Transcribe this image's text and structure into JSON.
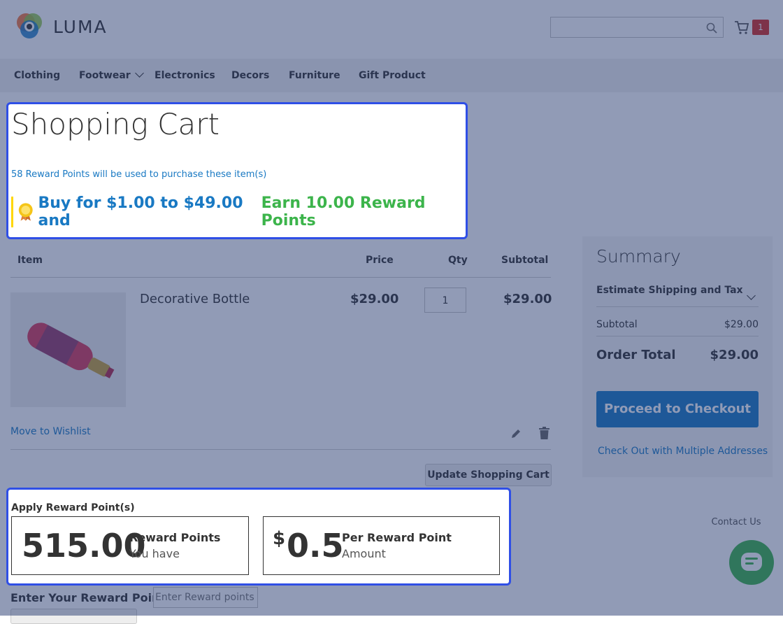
{
  "header": {
    "brand": "LUMA",
    "search_placeholder": "",
    "cart_count": "1"
  },
  "nav": {
    "items": [
      "Clothing",
      "Footwear",
      "Electronics",
      "Decors",
      "Furniture",
      "Gift Product"
    ]
  },
  "page": {
    "title": "Shopping Cart",
    "reward_note": "58 Reward Points will be used to purchase these item(s)",
    "earn_part1": "Buy for $1.00 to $49.00 and",
    "earn_part2": "Earn 10.00 Reward Points"
  },
  "cart": {
    "headers": {
      "item": "Item",
      "price": "Price",
      "qty": "Qty",
      "subtotal": "Subtotal"
    },
    "rows": [
      {
        "name": "Decorative Bottle",
        "price": "$29.00",
        "qty": "1",
        "subtotal": "$29.00"
      }
    ],
    "wishlist": "Move to Wishlist",
    "update_button": "Update Shopping Cart"
  },
  "summary": {
    "title": "Summary",
    "estimate": "Estimate Shipping and Tax",
    "subtotal_label": "Subtotal",
    "subtotal_value": "$29.00",
    "total_label": "Order Total",
    "total_value": "$29.00",
    "checkout_button": "Proceed to Checkout",
    "multi_link": "Check Out with Multiple Addresses"
  },
  "rewards": {
    "heading": "Apply Reward Point(s)",
    "points_value": "515.00",
    "points_label": "Reward Points",
    "points_sub": "You have",
    "rate_symbol": "$",
    "rate_value": "0.5",
    "rate_label": "Per Reward Point",
    "rate_sub": "Amount",
    "enter_label": "Enter Your Reward Points:",
    "enter_placeholder": "Enter Reward points"
  },
  "chat": {
    "label": "Contact Us"
  }
}
